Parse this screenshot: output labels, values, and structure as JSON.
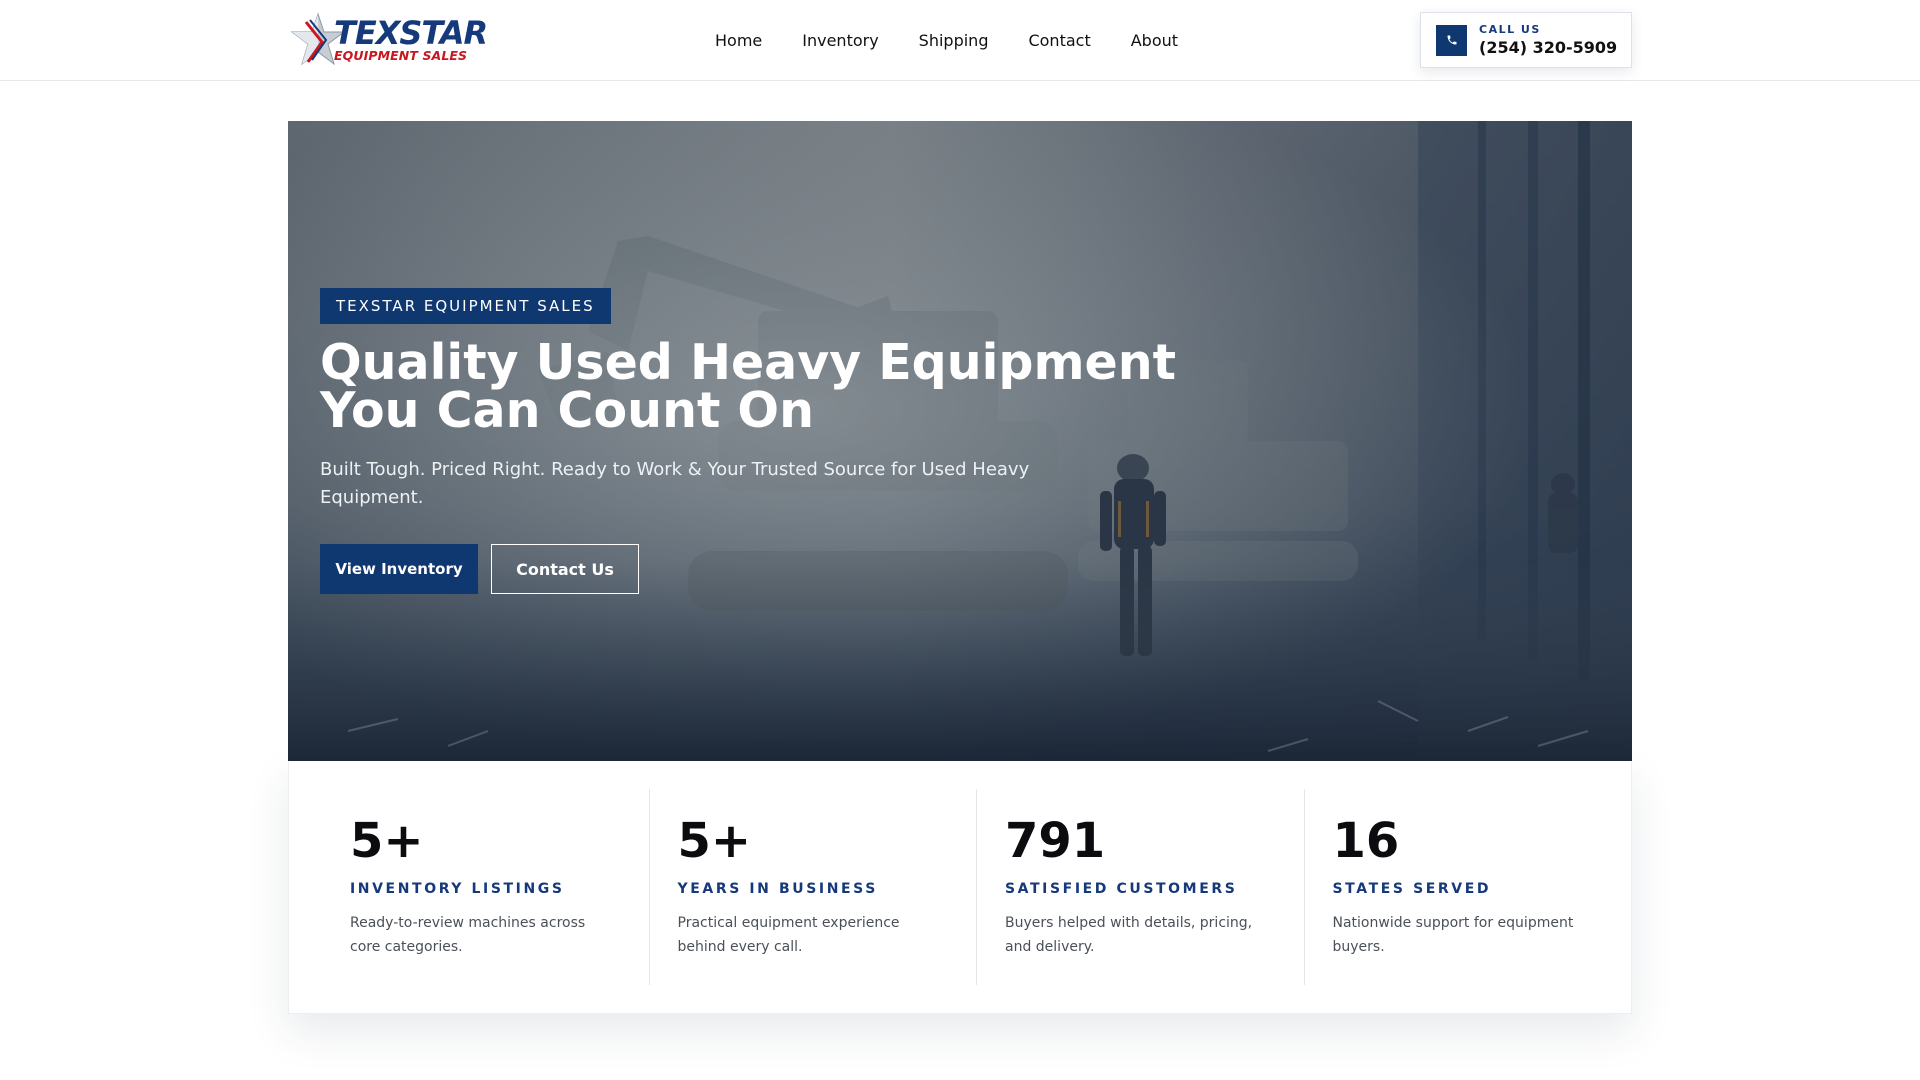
{
  "brand": {
    "name_top": "TEXSTAR",
    "name_bottom": "EQUIPMENT SALES",
    "colors": {
      "navy": "#0f3770",
      "red": "#c8171e"
    }
  },
  "nav": {
    "items": [
      {
        "label": "Home"
      },
      {
        "label": "Inventory"
      },
      {
        "label": "Shipping"
      },
      {
        "label": "Contact"
      },
      {
        "label": "About"
      }
    ]
  },
  "call": {
    "label": "CALL US",
    "number": "(254) 320-5909",
    "icon": "phone-icon"
  },
  "hero": {
    "badge": "TEXSTAR EQUIPMENT SALES",
    "title": "Quality Used Heavy Equipment You Can Count On",
    "subtitle": "Built Tough. Priced Right. Ready to Work & Your Trusted Source for Used Heavy Equipment.",
    "primary_button": "View Inventory",
    "secondary_button": "Contact Us"
  },
  "stats": [
    {
      "value": "5+",
      "label": "INVENTORY LISTINGS",
      "description": "Ready-to-review machines across core categories."
    },
    {
      "value": "5+",
      "label": "YEARS IN BUSINESS",
      "description": "Practical equipment experience behind every call."
    },
    {
      "value": "791",
      "label": "SATISFIED CUSTOMERS",
      "description": "Buyers helped with details, pricing, and delivery."
    },
    {
      "value": "16",
      "label": "STATES SERVED",
      "description": "Nationwide support for equipment buyers."
    }
  ]
}
